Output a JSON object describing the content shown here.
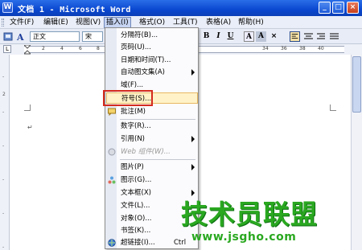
{
  "window": {
    "title": "文档 1 - Microsoft Word",
    "app_icon": "word-icon",
    "controls": [
      "_",
      "□",
      "×"
    ]
  },
  "menubar": {
    "items": [
      "文件(F)",
      "编辑(E)",
      "视图(V)",
      "插入(I)",
      "格式(O)",
      "工具(T)",
      "表格(A)",
      "帮助(H)"
    ],
    "active_index": 3
  },
  "toolbar": {
    "style_value": "正文",
    "font_value": "宋",
    "buttons": [
      "B",
      "I",
      "U",
      "A",
      "A",
      "×"
    ]
  },
  "ruler": {
    "left_numbers": [
      "2",
      "4",
      "6",
      "8"
    ],
    "right_numbers": [
      "34",
      "36",
      "38",
      "40"
    ],
    "corner_glyph": "L"
  },
  "insert_menu": {
    "items": [
      {
        "label": "分隔符(B)...",
        "icon": "",
        "submenu": false,
        "disabled": false
      },
      {
        "label": "页码(U)...",
        "icon": "",
        "submenu": false,
        "disabled": false
      },
      {
        "label": "日期和时间(T)...",
        "icon": "",
        "submenu": false,
        "disabled": false
      },
      {
        "label": "自动图文集(A)",
        "icon": "",
        "submenu": true,
        "disabled": false
      },
      {
        "label": "域(F)...",
        "icon": "",
        "submenu": false,
        "disabled": false
      },
      {
        "label": "符号(S)...",
        "icon": "",
        "submenu": false,
        "disabled": false,
        "highlighted": true
      },
      {
        "label": "批注(M)",
        "icon": "comment-icon",
        "submenu": false,
        "disabled": false
      },
      {
        "label": "数字(R)...",
        "icon": "",
        "submenu": false,
        "disabled": false
      },
      {
        "label": "引用(N)",
        "icon": "",
        "submenu": true,
        "disabled": false
      },
      {
        "label": "Web 组件(W)...",
        "icon": "web-component-icon",
        "submenu": false,
        "disabled": true
      },
      {
        "label": "图片(P)",
        "icon": "",
        "submenu": true,
        "disabled": false
      },
      {
        "label": "图示(G)...",
        "icon": "diagram-icon",
        "submenu": false,
        "disabled": false
      },
      {
        "label": "文本框(X)",
        "icon": "",
        "submenu": true,
        "disabled": false
      },
      {
        "label": "文件(L)...",
        "icon": "",
        "submenu": false,
        "disabled": false
      },
      {
        "label": "对象(O)...",
        "icon": "",
        "submenu": false,
        "disabled": false
      },
      {
        "label": "书签(K)...",
        "icon": "",
        "submenu": false,
        "disabled": false
      },
      {
        "label": "超链接(I)...",
        "icon": "hyperlink-icon",
        "submenu": false,
        "disabled": false
      },
      {
        "label": "Ctrl",
        "icon": "",
        "submenu": false,
        "disabled": false
      }
    ]
  },
  "document": {
    "paragraph_mark": "↵"
  },
  "watermark": {
    "title": "技术员联盟",
    "url": "www.jsgho.com"
  },
  "colors": {
    "title_bar": "#0a48d0",
    "highlight": "#fff2c8",
    "focus_outline": "#d42a1e",
    "watermark": "#2aa820"
  }
}
